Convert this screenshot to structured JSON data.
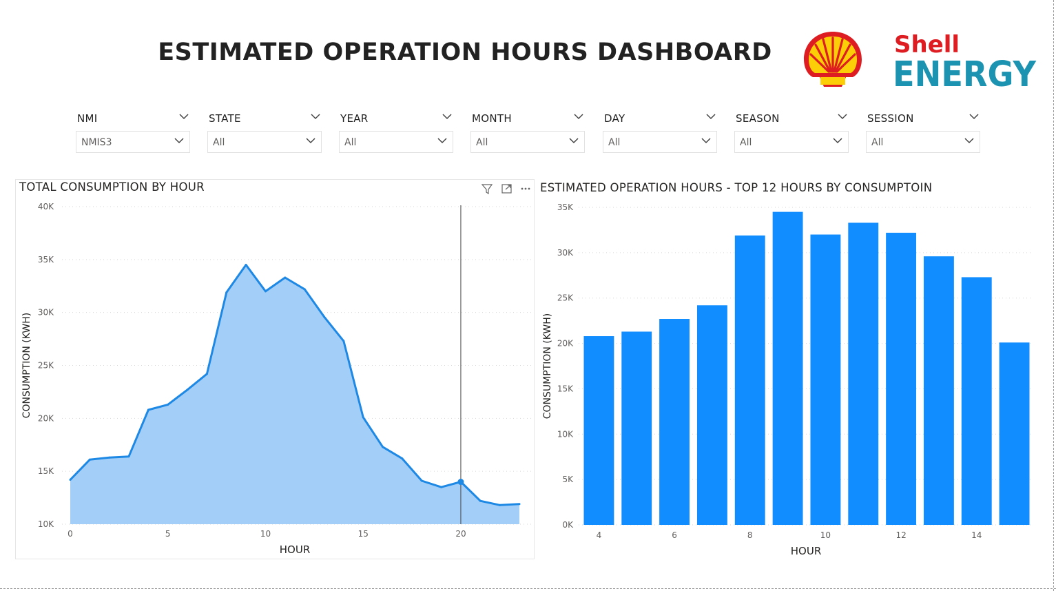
{
  "header": {
    "title": "ESTIMATED OPERATION HOURS DASHBOARD",
    "brand_line1": "Shell",
    "brand_line2": "ENERGY"
  },
  "icons": {
    "logo": "shell-pecten-logo",
    "chevron": "chevron-down-icon",
    "filter": "filter-icon",
    "focus": "focus-mode-icon",
    "more": "more-options-icon"
  },
  "colors": {
    "brand_red": "#DD1D21",
    "brand_yellow": "#FBCE07",
    "brand_teal": "#1B93B1",
    "line": "#1E88E5",
    "area": "#A3CEF8",
    "bar": "#118DFF"
  },
  "filters": [
    {
      "label": "NMI",
      "value": "NMIS3"
    },
    {
      "label": "STATE",
      "value": "All"
    },
    {
      "label": "YEAR",
      "value": "All"
    },
    {
      "label": "MONTH",
      "value": "All"
    },
    {
      "label": "DAY",
      "value": "All"
    },
    {
      "label": "SEASON",
      "value": "All"
    },
    {
      "label": "SESSION",
      "value": "All"
    }
  ],
  "chart_data": [
    {
      "type": "area",
      "title": "TOTAL CONSUMPTION BY HOUR",
      "xlabel": "HOUR",
      "ylabel": "CONSUMPTION (KWH)",
      "xlim": [
        0,
        23
      ],
      "ylim": [
        10000,
        40000
      ],
      "xticks": [
        0,
        5,
        10,
        15,
        20
      ],
      "xtick_labels": [
        "0",
        "5",
        "10",
        "15",
        "20"
      ],
      "yticks": [
        10000,
        15000,
        20000,
        25000,
        30000,
        35000,
        40000
      ],
      "ytick_labels": [
        "10K",
        "15K",
        "20K",
        "25K",
        "30K",
        "35K",
        "40K"
      ],
      "grid": true,
      "highlight_x": 20,
      "x": [
        0,
        1,
        2,
        3,
        4,
        5,
        6,
        7,
        8,
        9,
        10,
        11,
        12,
        13,
        14,
        15,
        16,
        17,
        18,
        19,
        20,
        21,
        22,
        23
      ],
      "y": [
        14200,
        16100,
        16300,
        16400,
        20800,
        21300,
        22700,
        24200,
        31900,
        34500,
        32000,
        33300,
        32200,
        29600,
        27300,
        20100,
        17300,
        16200,
        14100,
        13500,
        14000,
        12200,
        11800,
        11900
      ]
    },
    {
      "type": "bar",
      "title": "ESTIMATED OPERATION HOURS - TOP 12 HOURS BY CONSUMPTOIN",
      "xlabel": "HOUR",
      "ylabel": "CONSUMPTION (KWH)",
      "ylim": [
        0,
        35000
      ],
      "yticks": [
        0,
        5000,
        10000,
        15000,
        20000,
        25000,
        30000,
        35000
      ],
      "ytick_labels": [
        "0K",
        "5K",
        "10K",
        "15K",
        "20K",
        "25K",
        "30K",
        "35K"
      ],
      "xtick_values": [
        4,
        6,
        8,
        10,
        12,
        14
      ],
      "xtick_labels": [
        "4",
        "6",
        "8",
        "10",
        "12",
        "14"
      ],
      "grid": true,
      "categories": [
        4,
        5,
        6,
        7,
        8,
        9,
        10,
        11,
        12,
        13,
        14,
        15
      ],
      "values": [
        20800,
        21300,
        22700,
        24200,
        31900,
        34500,
        32000,
        33300,
        32200,
        29600,
        27300,
        20100
      ]
    }
  ]
}
